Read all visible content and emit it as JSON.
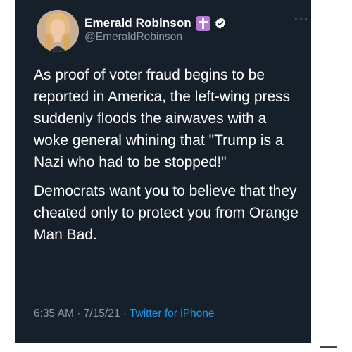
{
  "tweet": {
    "display_name": "Emerald Robinson",
    "handle": "@EmeraldRobinson",
    "paragraphs": [
      "As proof of voter fraud begins to be reported in America, the left-wing press suddenly floods the airwaves with a woke general whining that \"Trump is a Nazi who had to be stopped!\"",
      "Democrats want you to believe that they cheated only to protect you from Orange Man Bad."
    ],
    "time": "6:35 AM",
    "separator": "·",
    "date": "7/15/21",
    "source": "Twitter for iPhone"
  },
  "icons": {
    "avatar": "profile-photo",
    "badge": "cross-icon",
    "verified": "verified-badge-icon",
    "more": "more-options-icon"
  },
  "colors": {
    "background": "#15202b",
    "text": "#ffffff",
    "secondary_text": "#8b98a5",
    "link": "#1d9bf0",
    "cross_badge": "#b57ad4"
  }
}
